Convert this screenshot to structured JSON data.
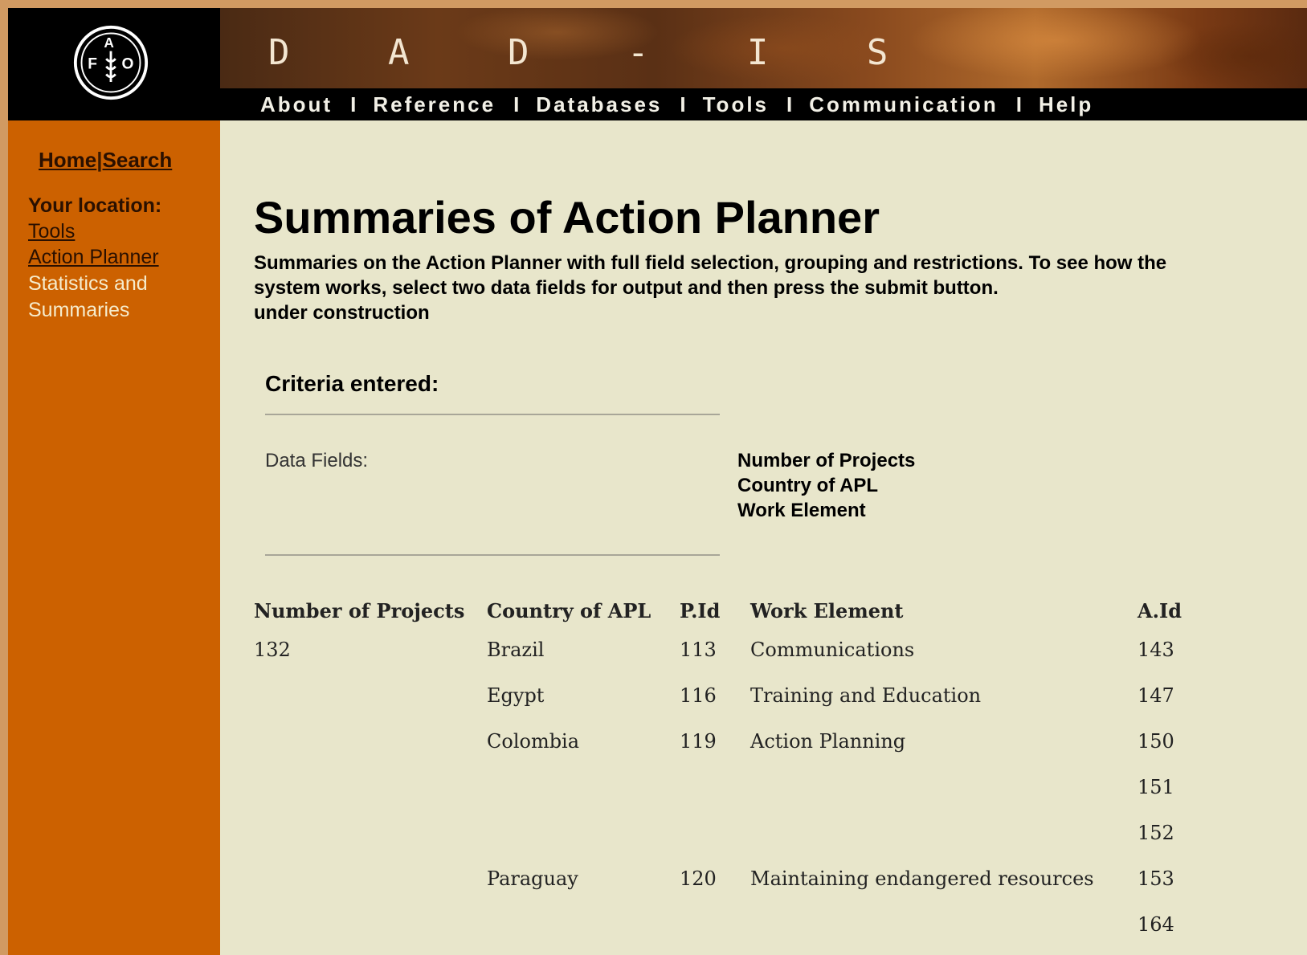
{
  "header": {
    "site_title": "D A D - I S",
    "nav": [
      {
        "label": "About"
      },
      {
        "label": "Reference"
      },
      {
        "label": "Databases"
      },
      {
        "label": "Tools"
      },
      {
        "label": "Communication"
      },
      {
        "label": "Help"
      }
    ],
    "separator": "I"
  },
  "sidebar": {
    "home_link": "Home",
    "search_link": "Search",
    "link_separator": "|",
    "location_label": "Your location:",
    "breadcrumbs": [
      "Tools",
      "Action Planner"
    ],
    "current_location": "Statistics and Summaries"
  },
  "main": {
    "title": "Summaries of Action Planner",
    "intro_line1": "Summaries on the Action Planner with full field selection, grouping and restrictions. To see how the system works, select two data fields for output and then press the submit button.",
    "intro_line2": "under construction",
    "criteria_heading": "Criteria entered:",
    "data_fields_label": "Data Fields:",
    "data_fields": [
      "Number of Projects",
      "Country of APL",
      "Work Element"
    ]
  },
  "table": {
    "headers": [
      "Number of Projects",
      "Country of APL",
      "P.Id",
      "Work Element",
      "A.Id"
    ],
    "rows": [
      [
        "132",
        "Brazil",
        "113",
        "Communications",
        "143"
      ],
      [
        "",
        "Egypt",
        "116",
        "Training and Education",
        "147"
      ],
      [
        "",
        "Colombia",
        "119",
        "Action Planning",
        "150"
      ],
      [
        "",
        "",
        "",
        "",
        "151"
      ],
      [
        "",
        "",
        "",
        "",
        "152"
      ],
      [
        "",
        "Paraguay",
        "120",
        "Maintaining endangered resources",
        "153"
      ],
      [
        "",
        "",
        "",
        "",
        "164"
      ]
    ]
  },
  "colors": {
    "sidebar": "#cc6100",
    "content_bg": "#e8e6cb",
    "header_bg": "#000000"
  },
  "icons": {
    "logo": "fao-logo-icon"
  }
}
